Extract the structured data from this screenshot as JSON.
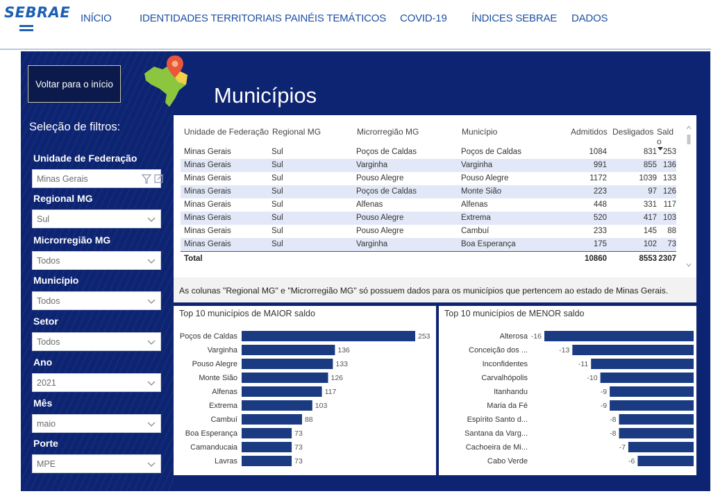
{
  "nav": {
    "logo": "SEBRAE",
    "items": [
      {
        "label": "INÍCIO"
      },
      {
        "label": "IDENTIDADES TERRITORIAIS"
      },
      {
        "label": "PAINÉIS TEMÁTICOS"
      },
      {
        "label": "COVID-19"
      },
      {
        "label": "ÍNDICES SEBRAE"
      },
      {
        "label": "DADOS"
      }
    ]
  },
  "dashboard": {
    "back_button": "Voltar para o início",
    "title": "Municípios",
    "filters_title": "Seleção de filtros:",
    "filters": [
      {
        "label": "Unidade de Federação",
        "value": "Minas Gerais"
      },
      {
        "label": "Regional MG",
        "value": "Sul"
      },
      {
        "label": "Microrregião MG",
        "value": "Todos"
      },
      {
        "label": "Município",
        "value": "Todos"
      },
      {
        "label": "Setor",
        "value": "Todos"
      },
      {
        "label": "Ano",
        "value": "2021"
      },
      {
        "label": "Mês",
        "value": "maio"
      },
      {
        "label": "Porte",
        "value": "MPE"
      }
    ]
  },
  "table": {
    "headers": [
      "Unidade de Federação",
      "Regional MG",
      "Microrregião MG",
      "Município",
      "Admitidos",
      "Desligados",
      "Sald",
      "o"
    ],
    "rows": [
      [
        "Minas Gerais",
        "Sul",
        "Poços de Caldas",
        "Poços de Caldas",
        "1084",
        "831",
        "253"
      ],
      [
        "Minas Gerais",
        "Sul",
        "Varginha",
        "Varginha",
        "991",
        "855",
        "136"
      ],
      [
        "Minas Gerais",
        "Sul",
        "Pouso Alegre",
        "Pouso Alegre",
        "1172",
        "1039",
        "133"
      ],
      [
        "Minas Gerais",
        "Sul",
        "Poços de Caldas",
        "Monte Sião",
        "223",
        "97",
        "126"
      ],
      [
        "Minas Gerais",
        "Sul",
        "Alfenas",
        "Alfenas",
        "448",
        "331",
        "117"
      ],
      [
        "Minas Gerais",
        "Sul",
        "Pouso Alegre",
        "Extrema",
        "520",
        "417",
        "103"
      ],
      [
        "Minas Gerais",
        "Sul",
        "Pouso Alegre",
        "Cambuí",
        "233",
        "145",
        "88"
      ],
      [
        "Minas Gerais",
        "Sul",
        "Varginha",
        "Boa Esperança",
        "175",
        "102",
        "73"
      ]
    ],
    "total": {
      "label": "Total",
      "admitidos": "10860",
      "desligados": "8553",
      "saldo": "2307"
    }
  },
  "note": "As colunas \"Regional MG\" e \"Microrregião MG\" só possuem dados para os municípios que pertencem ao estado de Minas Gerais.",
  "colors": {
    "navy": "#0d2472",
    "bar": "#1a3a82",
    "nav_text": "#1c4fa1"
  },
  "chart_data": [
    {
      "type": "bar",
      "orientation": "horizontal",
      "title": "Top 10 municípios de MAIOR saldo",
      "categories": [
        "Poços de Caldas",
        "Varginha",
        "Pouso Alegre",
        "Monte Sião",
        "Alfenas",
        "Extrema",
        "Cambuí",
        "Boa Esperança",
        "Camanducaia",
        "Lavras"
      ],
      "values": [
        253,
        136,
        133,
        126,
        117,
        103,
        88,
        73,
        73,
        73
      ]
    },
    {
      "type": "bar",
      "orientation": "horizontal",
      "title": "Top 10 municípios de MENOR saldo",
      "categories": [
        "Alterosa",
        "Conceição dos ...",
        "Inconfidentes",
        "Carvalhópolis",
        "Itanhandu",
        "Maria da Fé",
        "Espírito Santo d...",
        "Santana da Varg...",
        "Cachoeira de Mi...",
        "Cabo Verde"
      ],
      "values": [
        -16,
        -13,
        -11,
        -10,
        -9,
        -9,
        -8,
        -8,
        -7,
        -6
      ]
    }
  ]
}
